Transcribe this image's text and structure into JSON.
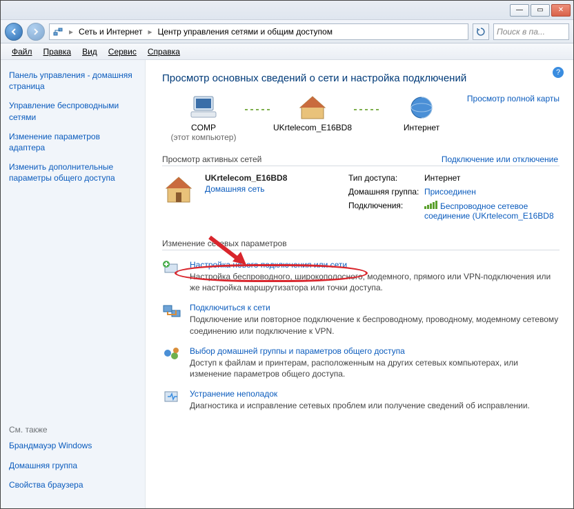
{
  "titlebar": {
    "min": "—",
    "max": "▭",
    "close": "✕"
  },
  "nav": {
    "breadcrumb1": "Сеть и Интернет",
    "breadcrumb2": "Центр управления сетями и общим доступом",
    "search_placeholder": "Поиск в па..."
  },
  "menu": {
    "file": "Файл",
    "edit": "Правка",
    "view": "Вид",
    "tools": "Сервис",
    "help": "Справка"
  },
  "sidebar": {
    "home": "Панель управления - домашняя страница",
    "wireless": "Управление беспроводными сетями",
    "adapter": "Изменение параметров адаптера",
    "sharing": "Изменить дополнительные параметры общего доступа",
    "seealso_hdr": "См. также",
    "firewall": "Брандмауэр Windows",
    "homegroup": "Домашняя группа",
    "browser": "Свойства браузера"
  },
  "content": {
    "heading": "Просмотр основных сведений о сети и настройка подключений",
    "fullmap": "Просмотр полной карты",
    "node_comp": "COMP",
    "node_comp_sub": "(этот компьютер)",
    "node_router": "UKrtelecom_E16BD8",
    "node_internet": "Интернет",
    "active_hdr": "Просмотр активных сетей",
    "active_link": "Подключение или отключение",
    "net_name": "UKrtelecom_E16BD8",
    "net_type": "Домашняя сеть",
    "lbl_access": "Тип доступа:",
    "val_access": "Интернет",
    "lbl_homegroup": "Домашняя группа:",
    "val_homegroup": "Присоединен",
    "lbl_conn": "Подключения:",
    "val_conn": "Беспроводное сетевое соединение (UKrtelecom_E16BD8",
    "change_hdr": "Изменение сетевых параметров",
    "task1_title": "Настройка нового подключения или сети",
    "task1_desc": "Настройка беспроводного, широкополосного, модемного, прямого или VPN-подключения или же настройка маршрутизатора или точки доступа.",
    "task2_title": "Подключиться к сети",
    "task2_desc": "Подключение или повторное подключение к беспроводному, проводному, модемному сетевому соединению или подключение к VPN.",
    "task3_title": "Выбор домашней группы и параметров общего доступа",
    "task3_desc": "Доступ к файлам и принтерам, расположенным на других сетевых компьютерах, или изменение параметров общего доступа.",
    "task4_title": "Устранение неполадок",
    "task4_desc": "Диагностика и исправление сетевых проблем или получение сведений об исправлении."
  }
}
